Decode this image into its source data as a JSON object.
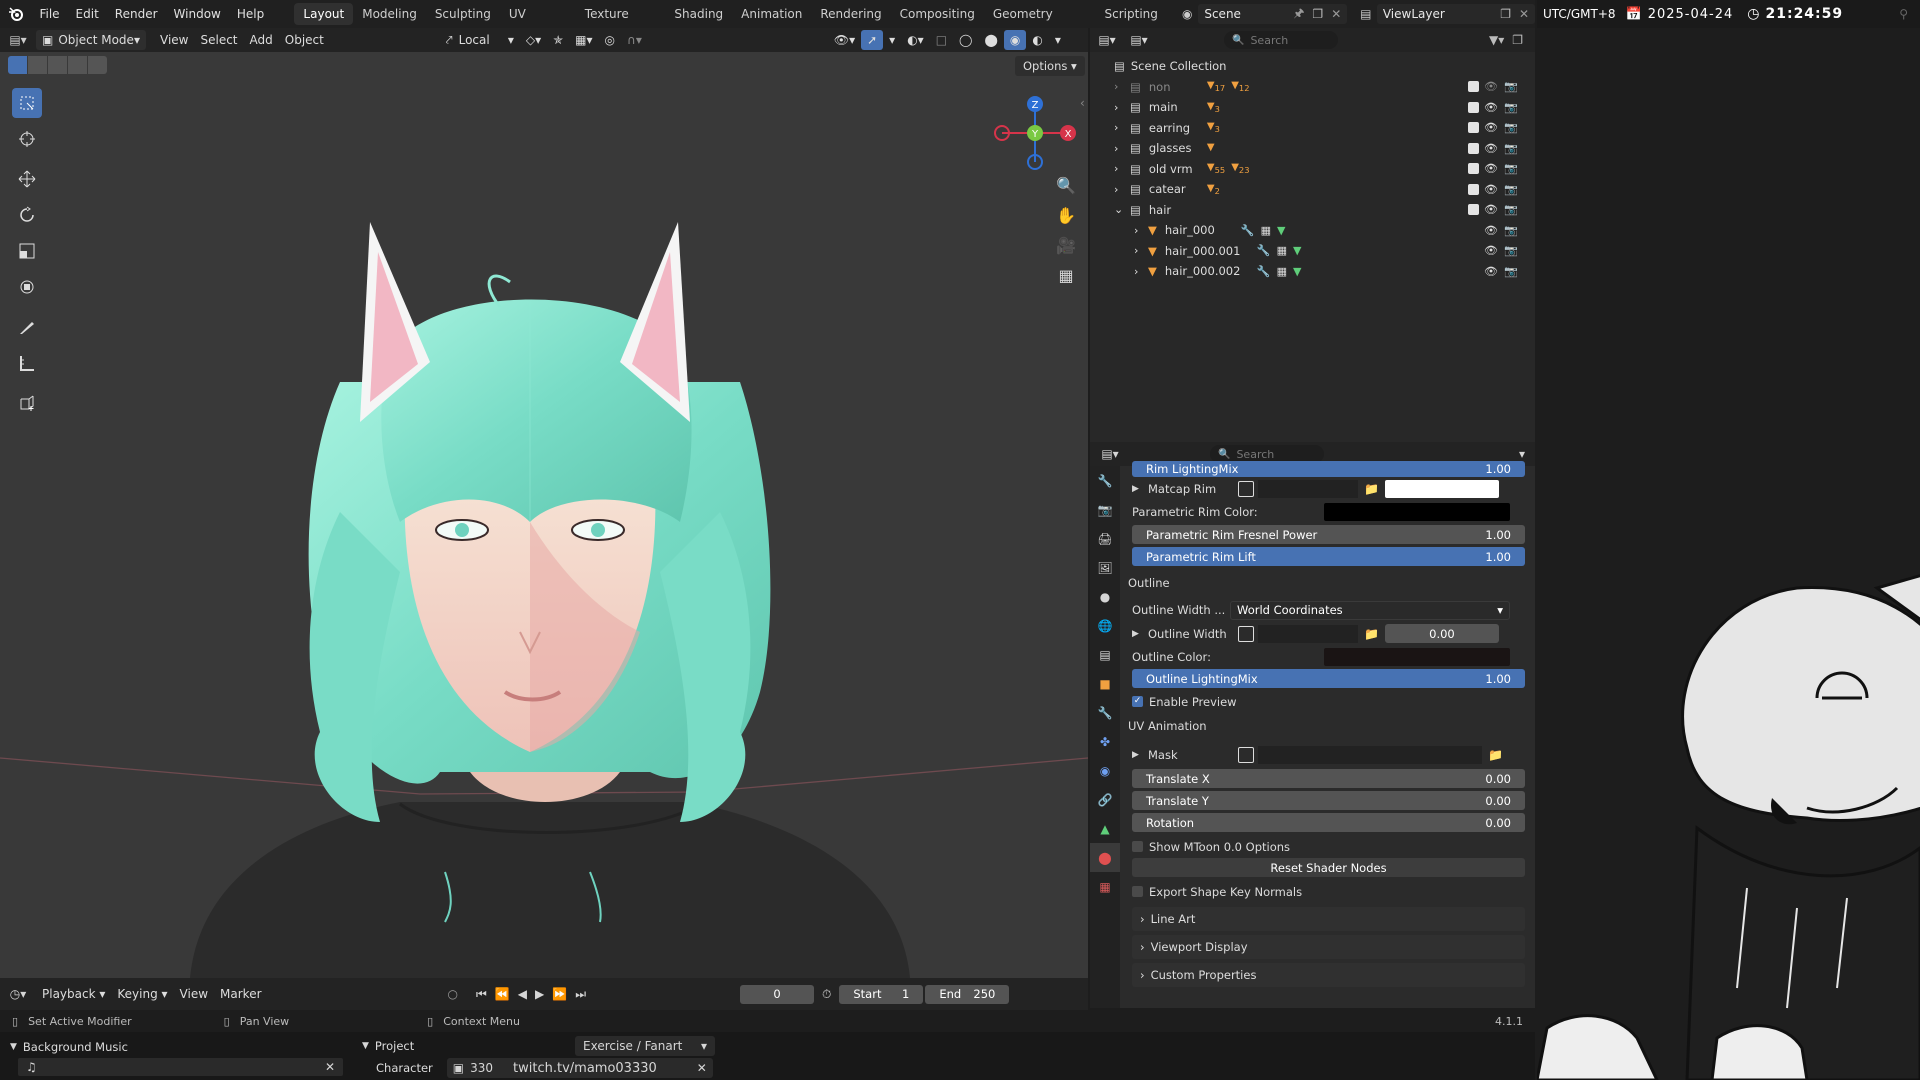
{
  "topbar": {
    "menus": [
      "File",
      "Edit",
      "Render",
      "Window",
      "Help"
    ],
    "workspaces": [
      "Layout",
      "Modeling",
      "Sculpting",
      "UV Editing",
      "Texture Paint",
      "Shading",
      "Animation",
      "Rendering",
      "Compositing",
      "Geometry Nodes",
      "Scripting"
    ],
    "active_workspace": "Layout",
    "scene": "Scene",
    "view_layer": "ViewLayer"
  },
  "clock": {
    "timezone": "UTC/GMT+8",
    "date": "2025-04-24",
    "time": "21:24:59"
  },
  "viewport_header": {
    "mode": "Object Mode",
    "menus": [
      "View",
      "Select",
      "Add",
      "Object"
    ],
    "orientation": "Local",
    "options_label": "Options"
  },
  "gizmo": {
    "z": "Z",
    "y": "Y",
    "x": "X"
  },
  "outliner": {
    "search_placeholder": "Search",
    "root": "Scene Collection",
    "collections": [
      {
        "name": "non",
        "badges": [
          "17",
          "12"
        ],
        "dim": true
      },
      {
        "name": "main",
        "badges": [
          "3"
        ]
      },
      {
        "name": "earring",
        "badges": [
          "3"
        ]
      },
      {
        "name": "glasses",
        "badges": [
          ""
        ]
      },
      {
        "name": "old vrm",
        "badges": [
          "55",
          "23"
        ]
      },
      {
        "name": "catear",
        "badges": [
          "2"
        ]
      },
      {
        "name": "hair",
        "badges": [],
        "expanded": true
      }
    ],
    "objects": [
      "hair_000",
      "hair_000.001",
      "hair_000.002"
    ]
  },
  "properties": {
    "search_placeholder": "Search",
    "rim_lighting_mix": {
      "label": "Rim LightingMix",
      "value": "1.00"
    },
    "matcap_rim": {
      "label": "Matcap Rim"
    },
    "parametric_rim_color_label": "Parametric Rim Color:",
    "parametric_rim_fresnel": {
      "label": "Parametric Rim Fresnel Power",
      "value": "1.00"
    },
    "parametric_rim_lift": {
      "label": "Parametric Rim Lift",
      "value": "1.00"
    },
    "outline_heading": "Outline",
    "outline_width_mode": {
      "label": "Outline Width ...",
      "value": "World Coordinates"
    },
    "outline_width": {
      "label": "Outline Width",
      "value": "0.00"
    },
    "outline_color_label": "Outline Color:",
    "outline_lighting_mix": {
      "label": "Outline LightingMix",
      "value": "1.00"
    },
    "enable_preview": "Enable Preview",
    "uv_heading": "UV Animation",
    "mask_label": "Mask",
    "translate_x": {
      "label": "Translate X",
      "value": "0.00"
    },
    "translate_y": {
      "label": "Translate Y",
      "value": "0.00"
    },
    "rotation": {
      "label": "Rotation",
      "value": "0.00"
    },
    "show_mtoon": "Show MToon 0.0 Options",
    "reset_shader": "Reset Shader Nodes",
    "export_shape": "Export Shape Key Normals",
    "panels": [
      "Line Art",
      "Viewport Display",
      "Custom Properties"
    ],
    "version": "4.1.1"
  },
  "timeline": {
    "menus": [
      "Playback",
      "Keying",
      "View",
      "Marker"
    ],
    "current_frame": "0",
    "start_label": "Start",
    "start": "1",
    "end_label": "End",
    "end": "250"
  },
  "status": {
    "left": "Set Active Modifier",
    "middle": "Pan View",
    "right": "Context Menu"
  },
  "bottom": {
    "bg_music_label": "Background Music",
    "project_label": "Project",
    "project_value": "Exercise / Fanart",
    "character_label": "Character",
    "character_num": "330",
    "twitch": "twitch.tv/mamo03330"
  },
  "colors": {
    "accent": "#4772b3",
    "hair": "#7fe3cc",
    "rim_white": "#ffffff",
    "rim_color": "#000000",
    "outline_color": "#1a1414"
  }
}
